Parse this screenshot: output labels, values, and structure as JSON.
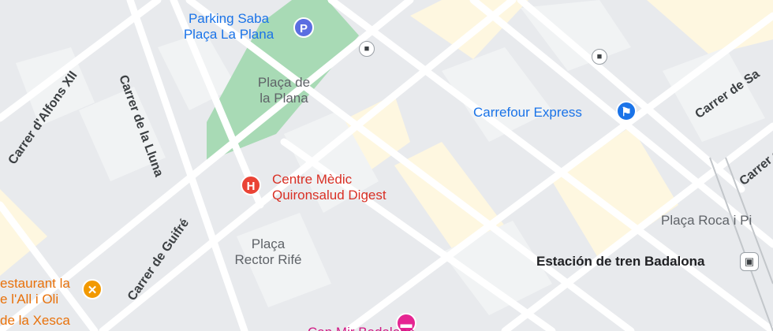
{
  "colors": {
    "background": "#e8eaed",
    "block": "#f1f3f4",
    "road": "#ffffff",
    "park": "#a8dab5",
    "highlight": "#fef7e0",
    "pin_parking": "#5b6ee1",
    "pin_hospital": "#ea4335",
    "pin_shopping": "#1a73e8",
    "pin_food": "#f29900",
    "pin_hotel": "#e52592"
  },
  "places": {
    "parking": {
      "line1": "Parking Saba",
      "line2": "Plaça La Plana",
      "icon": "P",
      "icon_name": "parking-icon"
    },
    "square_plana": {
      "line1": "Plaça de",
      "line2": "la Plana"
    },
    "carrefour": {
      "name": "Carrefour Express",
      "icon_name": "shopping-cart-icon"
    },
    "medical": {
      "line1": "Centre Mèdic",
      "line2": "Quironsalud Digest",
      "icon": "H",
      "icon_name": "hospital-icon"
    },
    "square_rector": {
      "line1": "Plaça",
      "line2": "Rector Rifé"
    },
    "square_roca": {
      "name": "Plaça Roca i Pi"
    },
    "station": {
      "name": "Estación de tren Badalona",
      "icon_name": "train-station-icon"
    },
    "restaurant": {
      "line1": "estaurant la",
      "line2": "e l'All i Oli",
      "icon_name": "restaurant-icon"
    },
    "xesca": {
      "name": "de la Xesca"
    },
    "hotel": {
      "name": "Can Mir Badalona",
      "icon_name": "hotel-icon"
    }
  },
  "streets": {
    "alfons": "Carrer d'Alfons XII",
    "lluna": "Carrer de la Lluna",
    "guifre": "Carrer de Guifré",
    "sant_right": "Carrer de Sa",
    "right_edge": "Carrer de"
  },
  "icons": {
    "bus": "bus-stop-icon"
  }
}
